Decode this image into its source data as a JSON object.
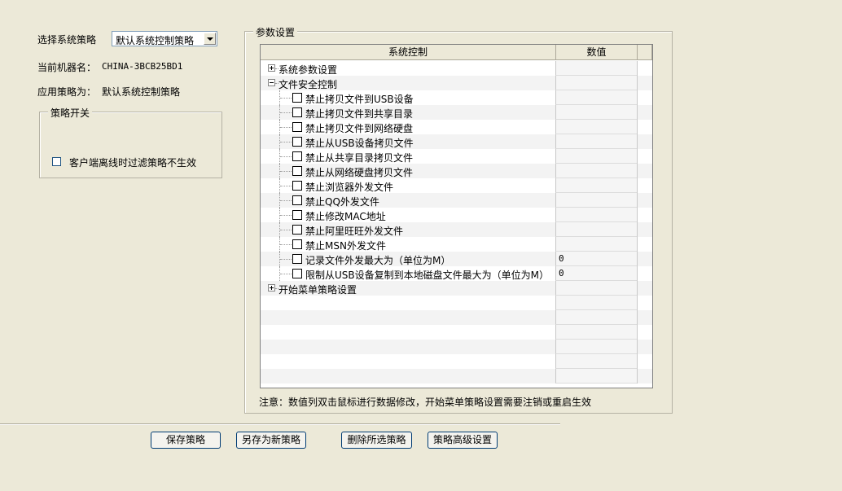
{
  "left": {
    "select_policy_label": "选择系统策略",
    "select_policy_value": "默认系统控制策略",
    "machine_name_label": "当前机器名：",
    "machine_name_value": "CHINA-3BCB25BD1",
    "applied_policy_label": "应用策略为：",
    "applied_policy_value": "默认系统控制策略",
    "switch_group_title": "策略开关",
    "offline_checkbox_label": "客户端离线时过滤策略不生效",
    "offline_checkbox_checked": false
  },
  "params": {
    "group_title": "参数设置",
    "columns": [
      "系统控制",
      "数值"
    ],
    "rows": [
      {
        "type": "node",
        "label": "系统参数设置",
        "expanded": false,
        "value": ""
      },
      {
        "type": "node",
        "label": "文件安全控制",
        "expanded": true,
        "value": ""
      },
      {
        "type": "item",
        "label": "禁止拷贝文件到USB设备",
        "checked": false,
        "value": ""
      },
      {
        "type": "item",
        "label": "禁止拷贝文件到共享目录",
        "checked": false,
        "value": ""
      },
      {
        "type": "item",
        "label": "禁止拷贝文件到网络硬盘",
        "checked": false,
        "value": ""
      },
      {
        "type": "item",
        "label": "禁止从USB设备拷贝文件",
        "checked": false,
        "value": ""
      },
      {
        "type": "item",
        "label": "禁止从共享目录拷贝文件",
        "checked": false,
        "value": ""
      },
      {
        "type": "item",
        "label": "禁止从网络硬盘拷贝文件",
        "checked": false,
        "value": ""
      },
      {
        "type": "item",
        "label": "禁止浏览器外发文件",
        "checked": false,
        "value": ""
      },
      {
        "type": "item",
        "label": "禁止QQ外发文件",
        "checked": false,
        "value": ""
      },
      {
        "type": "item",
        "label": "禁止修改MAC地址",
        "checked": false,
        "value": ""
      },
      {
        "type": "item",
        "label": "禁止阿里旺旺外发文件",
        "checked": false,
        "value": ""
      },
      {
        "type": "item",
        "label": "禁止MSN外发文件",
        "checked": false,
        "value": ""
      },
      {
        "type": "item",
        "label": "记录文件外发最大为（单位为M）",
        "checked": false,
        "value": "0"
      },
      {
        "type": "item",
        "label": "限制从USB设备复制到本地磁盘文件最大为（单位为M）",
        "checked": false,
        "value": "0"
      },
      {
        "type": "node",
        "label": "开始菜单策略设置",
        "expanded": false,
        "value": ""
      }
    ],
    "note": "注意：数值列双击鼠标进行数据修改，开始菜单策略设置需要注销或重启生效"
  },
  "buttons": {
    "save": "保存策略",
    "save_as": "另存为新策略",
    "delete": "删除所选策略",
    "advanced": "策略高级设置"
  }
}
